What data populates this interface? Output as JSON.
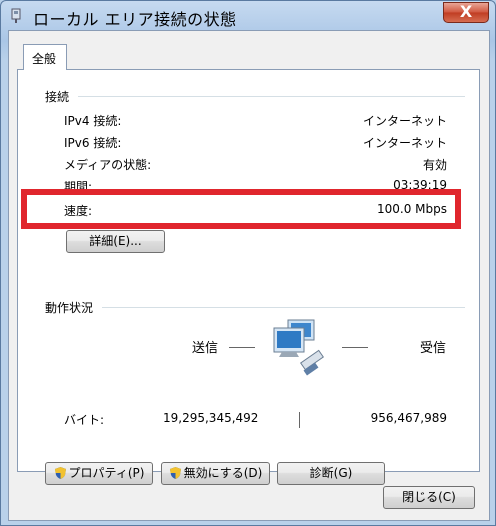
{
  "window": {
    "title": "ローカル エリア接続の状態",
    "close_glyph": "X"
  },
  "tab": {
    "label": "全般"
  },
  "connection": {
    "header": "接続",
    "rows": [
      {
        "label": "IPv4 接続:",
        "value": "インターネット"
      },
      {
        "label": "IPv6 接続:",
        "value": "インターネット"
      },
      {
        "label": "メディアの状態:",
        "value": "有効"
      },
      {
        "label": "期間:",
        "value": "03:39:19"
      },
      {
        "label": "速度:",
        "value": "100.0 Mbps"
      }
    ],
    "details_button": "詳細(E)..."
  },
  "activity": {
    "header": "動作状況",
    "sent_label": "送信",
    "received_label": "受信",
    "bytes_label": "バイト:",
    "bytes_sent": "19,295,345,492",
    "bytes_received": "956,467,989"
  },
  "buttons": {
    "properties": "プロパティ(P)",
    "disable": "無効にする(D)",
    "diagnose": "診断(G)",
    "close": "閉じる(C)"
  },
  "colors": {
    "highlight": "#e0262d",
    "shield_blue": "#2f5fb0",
    "shield_yellow": "#f2c230"
  }
}
